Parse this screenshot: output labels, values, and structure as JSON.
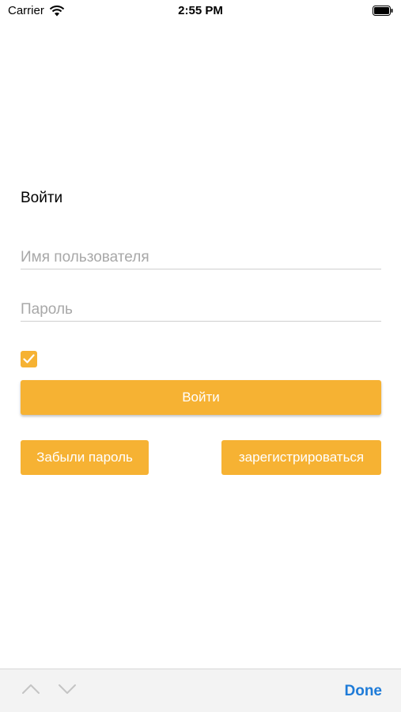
{
  "status_bar": {
    "carrier": "Carrier",
    "time": "2:55 PM"
  },
  "login": {
    "title": "Войти",
    "username_placeholder": "Имя пользователя",
    "password_placeholder": "Пароль",
    "remember_checked": true,
    "login_button": "Войти",
    "forgot_button": "Забыли пароль",
    "register_button": "зарегистрироваться"
  },
  "keyboard_toolbar": {
    "done": "Done"
  },
  "colors": {
    "accent": "#f6b233",
    "done": "#1e7bd8"
  },
  "icons": [
    "wifi-icon",
    "battery-icon",
    "checkmark-icon",
    "chevron-up-icon",
    "chevron-down-icon"
  ]
}
